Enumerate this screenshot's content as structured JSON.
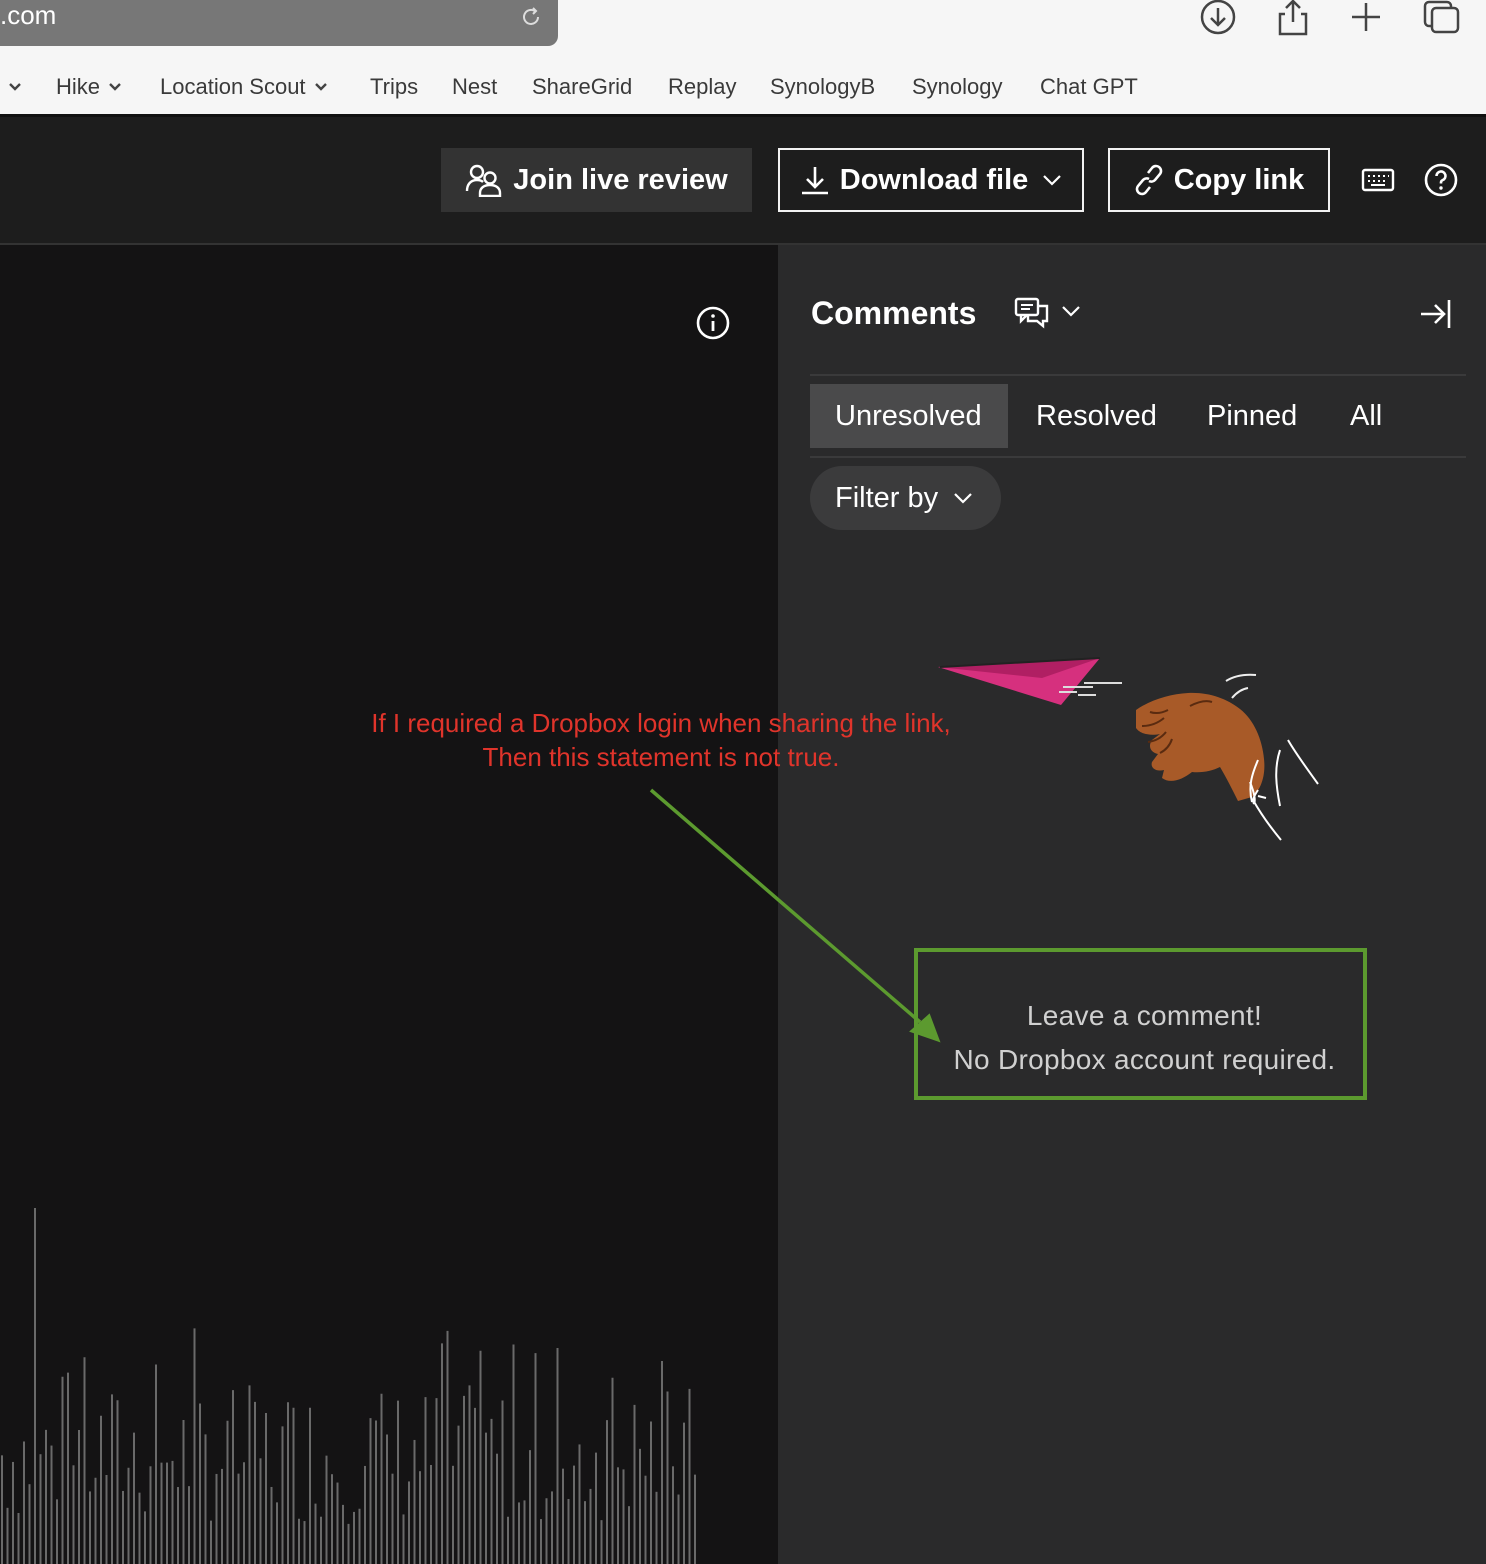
{
  "browser": {
    "url_fragment": ".com",
    "bookmarks": [
      {
        "label": "",
        "has_chevron": true
      },
      {
        "label": "Hike",
        "has_chevron": true
      },
      {
        "label": "Location Scout",
        "has_chevron": true
      },
      {
        "label": "Trips",
        "has_chevron": false
      },
      {
        "label": "Nest",
        "has_chevron": false
      },
      {
        "label": "ShareGrid",
        "has_chevron": false
      },
      {
        "label": "Replay",
        "has_chevron": false
      },
      {
        "label": "SynologyB",
        "has_chevron": false
      },
      {
        "label": "Synology",
        "has_chevron": false
      },
      {
        "label": "Chat GPT",
        "has_chevron": false
      }
    ]
  },
  "toolbar": {
    "join_label": "Join live review",
    "download_label": "Download file",
    "copy_label": "Copy link"
  },
  "comments": {
    "title": "Comments",
    "tabs": [
      {
        "label": "Unresolved",
        "active": true
      },
      {
        "label": "Resolved",
        "active": false
      },
      {
        "label": "Pinned",
        "active": false
      },
      {
        "label": "All",
        "active": false
      }
    ],
    "filter_label": "Filter by",
    "empty_line1": "Leave a comment!",
    "empty_line2": "No Dropbox account required."
  },
  "annotation": {
    "line1": "If I required a Dropbox login when sharing the link,",
    "line2": "Then this statement is not true.",
    "text_color": "#e0342b",
    "arrow_color": "#5c9a2f"
  },
  "colors": {
    "panel_bg": "#2a2a2b",
    "viewer_bg": "#141314",
    "toolbar_bg": "#1d1d1d",
    "plane": "#d6307e",
    "hand": "#a85a28"
  }
}
